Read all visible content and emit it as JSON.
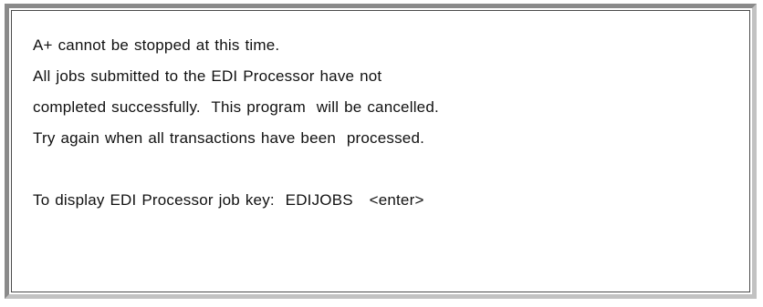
{
  "dialog": {
    "lines": [
      "A+ cannot be stopped at this time.",
      "All jobs submitted to the EDI Processor have not",
      "completed successfully.  This program  will be cancelled.",
      "Try again when all transactions have been  processed."
    ],
    "instruction": "To display EDI Processor job key:  EDIJOBS   <enter>"
  }
}
